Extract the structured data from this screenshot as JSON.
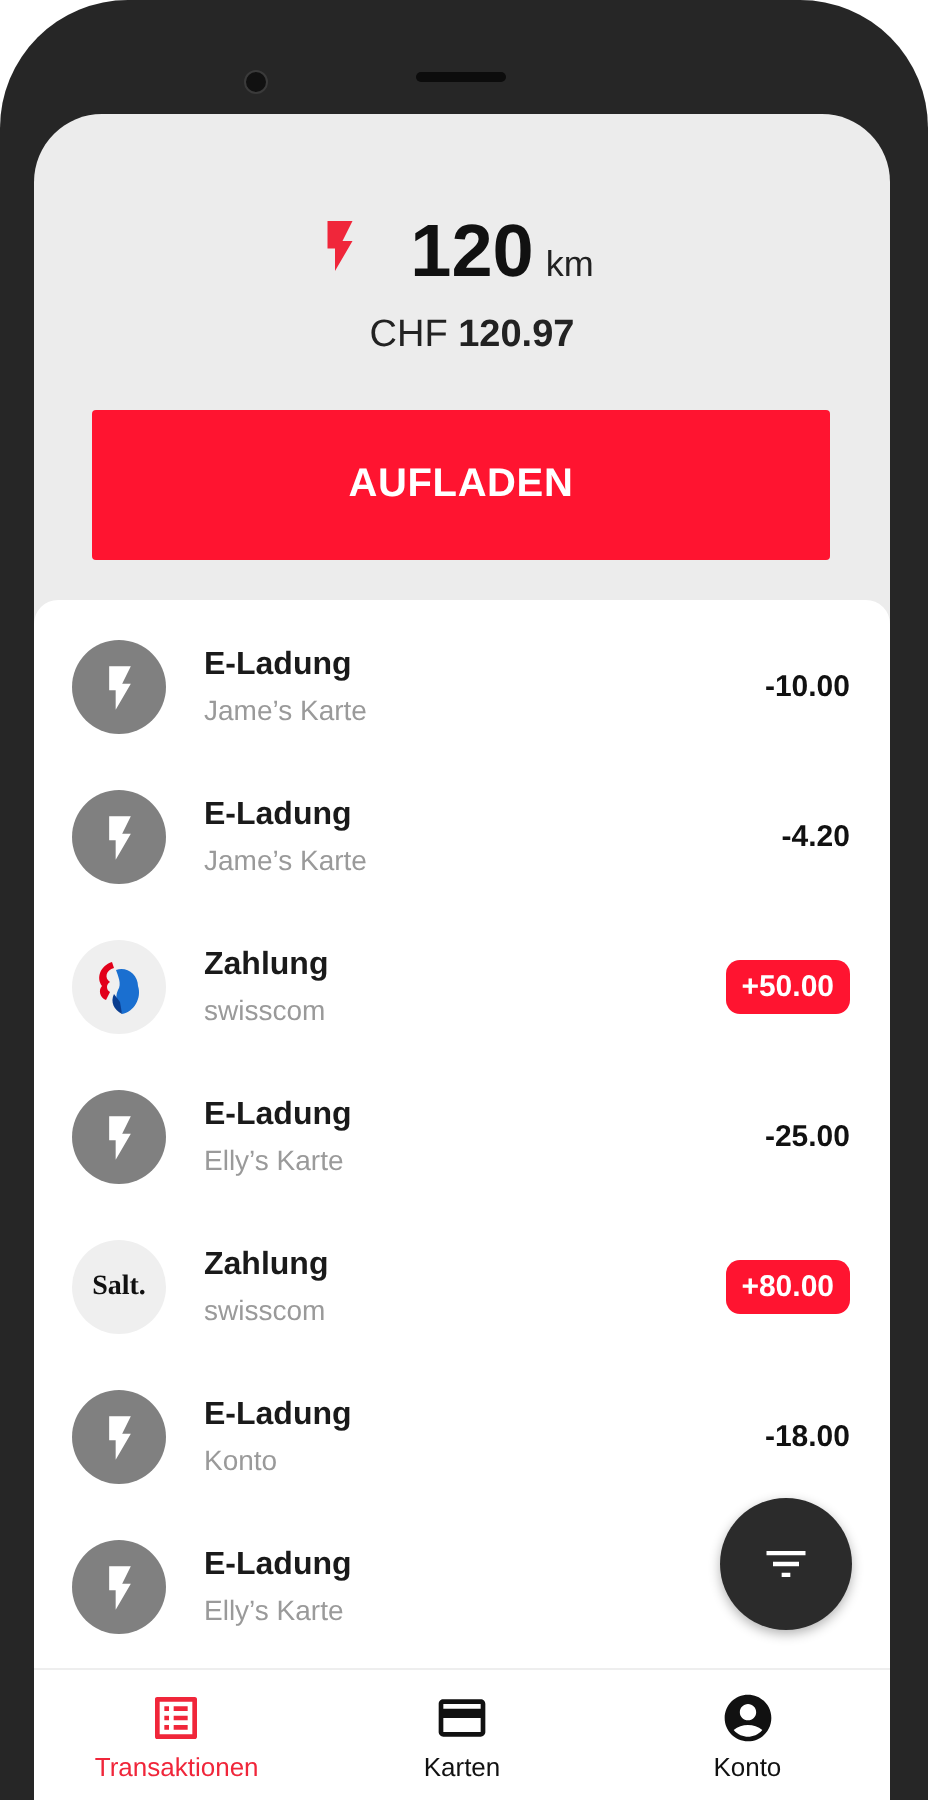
{
  "balance": {
    "range": "120",
    "unit": "km",
    "currency": "CHF",
    "amount": "120.97"
  },
  "topup_button": "AUFLADEN",
  "transactions": [
    {
      "kind": "charge",
      "title": "E-Ladung",
      "subtitle": "Jame’s Karte",
      "amount": "-10.00",
      "credit": false
    },
    {
      "kind": "charge",
      "title": "E-Ladung",
      "subtitle": "Jame’s Karte",
      "amount": "-4.20",
      "credit": false
    },
    {
      "kind": "swisscom",
      "title": "Zahlung",
      "subtitle": "swisscom",
      "amount": "+50.00",
      "credit": true
    },
    {
      "kind": "charge",
      "title": "E-Ladung",
      "subtitle": "Elly’s Karte",
      "amount": "-25.00",
      "credit": false
    },
    {
      "kind": "salt",
      "logo_text": "Salt.",
      "title": "Zahlung",
      "subtitle": "swisscom",
      "amount": "+80.00",
      "credit": true
    },
    {
      "kind": "charge",
      "title": "E-Ladung",
      "subtitle": "Konto",
      "amount": "-18.00",
      "credit": false
    },
    {
      "kind": "charge",
      "title": "E-Ladung",
      "subtitle": "Elly’s Karte"
    }
  ],
  "nav": [
    {
      "label": "Transaktionen",
      "selected": true
    },
    {
      "label": "Karten",
      "selected": false
    },
    {
      "label": "Konto",
      "selected": false
    }
  ]
}
